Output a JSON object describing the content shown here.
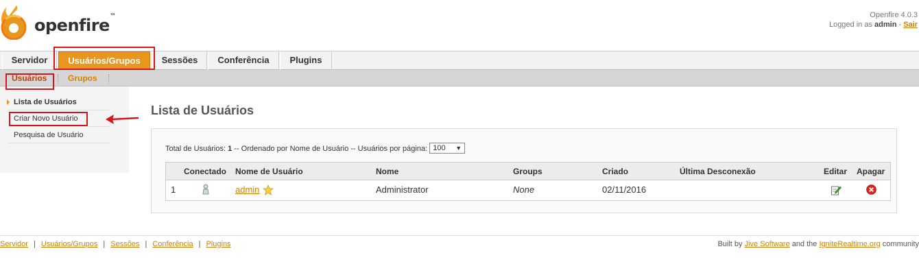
{
  "brand": {
    "name": "openfire",
    "tm": "™"
  },
  "userinfo": {
    "version": "Openfire 4.0.3",
    "logged_prefix": "Logged in as ",
    "user": "admin",
    "dash": " - ",
    "logout": "Sair"
  },
  "tabs": [
    {
      "label": "Servidor"
    },
    {
      "label": "Usuários/Grupos",
      "active": true
    },
    {
      "label": "Sessões"
    },
    {
      "label": "Conferência"
    },
    {
      "label": "Plugins"
    }
  ],
  "subtabs": [
    {
      "label": "Usuários",
      "active": true
    },
    {
      "label": "Grupos"
    }
  ],
  "sidebar": {
    "items": [
      {
        "label": "Lista de Usuários",
        "active": true
      },
      {
        "label": "Criar Novo Usuário"
      },
      {
        "label": "Pesquisa de Usuário"
      }
    ]
  },
  "main": {
    "title": "Lista de Usuários",
    "summary": {
      "prefix": "Total de Usuários: ",
      "total": "1",
      "middle": " -- Ordenado por Nome de Usuário -- Usuários por página: ",
      "per_page": "100"
    },
    "table": {
      "headers": [
        "Conectado",
        "Nome de Usuário",
        "Nome",
        "Groups",
        "Criado",
        "Última Desconexão",
        "Editar",
        "Apagar"
      ],
      "rows": [
        {
          "index": "1",
          "username": "admin",
          "name": "Administrator",
          "groups": "None",
          "created": "02/11/2016",
          "last_logout": ""
        }
      ]
    }
  },
  "footer": {
    "links": [
      "Servidor",
      "Usuários/Grupos",
      "Sessões",
      "Conferência",
      "Plugins"
    ],
    "credit_prefix": "Built by ",
    "credit_link1": "Jive Software",
    "credit_mid": " and the ",
    "credit_link2": "IgniteRealtime.org",
    "credit_suffix": " community"
  },
  "colors": {
    "accent": "#e8961e",
    "link": "#d68000",
    "highlight": "#d4161c"
  },
  "icons": [
    "openfire-flame-icon",
    "offline-user-icon",
    "admin-star-icon",
    "edit-icon",
    "delete-icon",
    "select-arrow-icon",
    "annotation-arrow-icon"
  ]
}
